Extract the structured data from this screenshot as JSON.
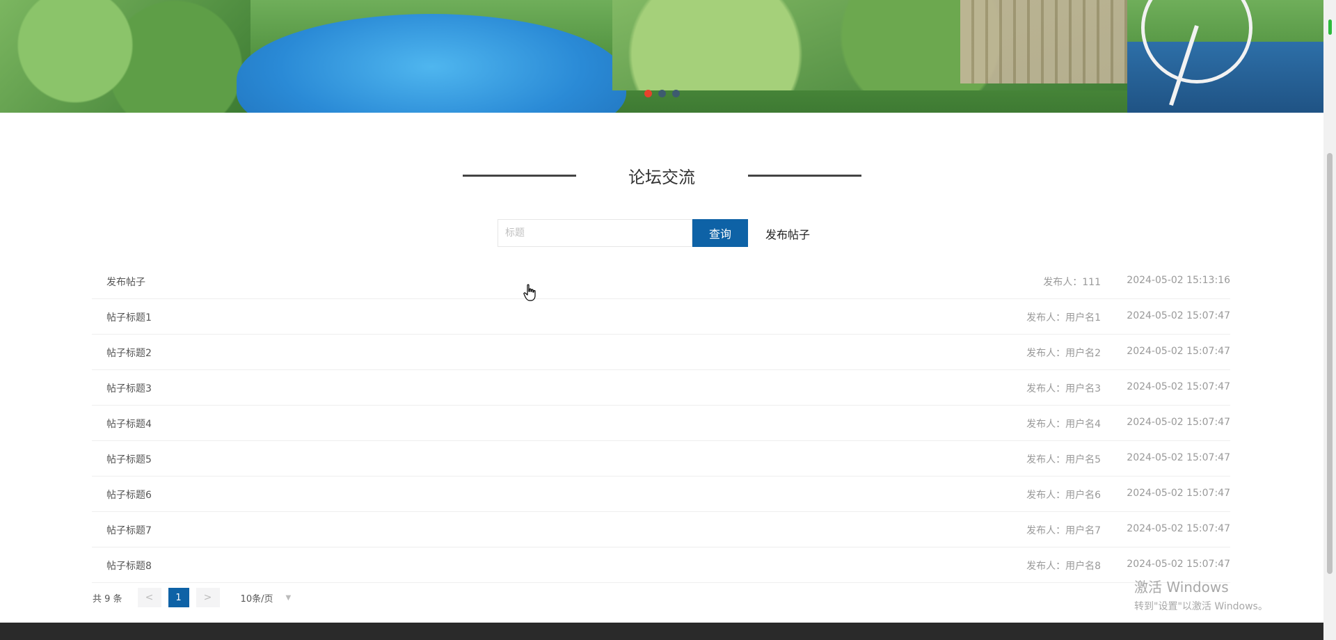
{
  "banner": {
    "active_slide": 1,
    "slide_count": 3
  },
  "section": {
    "title": "论坛交流"
  },
  "search": {
    "placeholder": "标题",
    "value": "",
    "button_label": "查询",
    "publish_label": "发布帖子"
  },
  "posts": [
    {
      "title": "发布帖子",
      "author": "发布人：111",
      "time": "2024-05-02 15:13:16"
    },
    {
      "title": "帖子标题1",
      "author": "发布人：用户名1",
      "time": "2024-05-02 15:07:47"
    },
    {
      "title": "帖子标题2",
      "author": "发布人：用户名2",
      "time": "2024-05-02 15:07:47"
    },
    {
      "title": "帖子标题3",
      "author": "发布人：用户名3",
      "time": "2024-05-02 15:07:47"
    },
    {
      "title": "帖子标题4",
      "author": "发布人：用户名4",
      "time": "2024-05-02 15:07:47"
    },
    {
      "title": "帖子标题5",
      "author": "发布人：用户名5",
      "time": "2024-05-02 15:07:47"
    },
    {
      "title": "帖子标题6",
      "author": "发布人：用户名6",
      "time": "2024-05-02 15:07:47"
    },
    {
      "title": "帖子标题7",
      "author": "发布人：用户名7",
      "time": "2024-05-02 15:07:47"
    },
    {
      "title": "帖子标题8",
      "author": "发布人：用户名8",
      "time": "2024-05-02 15:07:47"
    }
  ],
  "pagination": {
    "total_label": "共 9 条",
    "prev_label": "<",
    "current_page": "1",
    "next_label": ">",
    "page_size_label": "10条/页"
  },
  "watermark": {
    "line1": "激活 Windows",
    "line2": "转到\"设置\"以激活 Windows。"
  },
  "colors": {
    "primary": "#0e62a6",
    "active_dot": "#e8412c",
    "footer": "#2a2a2a"
  },
  "icons": {
    "cursor": "hand-pointer-icon",
    "page_size_caret": "chevron-down-icon"
  }
}
